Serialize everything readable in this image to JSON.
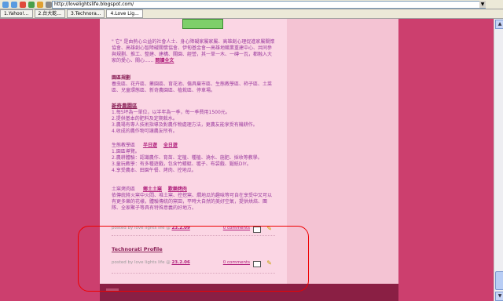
{
  "browser": {
    "address": "http://lovelightslife.blogspot.com/",
    "dropdown_glyph": "▼",
    "tabs": [
      {
        "label": "1.Yahoo!..."
      },
      {
        "label": "2.台大乾..."
      },
      {
        "label": "3.Technora..."
      },
      {
        "label": "4.Love Lig..."
      }
    ]
  },
  "post": {
    "intro": "\" 它\" 是由熱心公益的社會人士、身心障礙家屬家屬、高雄創心理促進家屬關懷協會、高雄創心智障礙關懷協會、伊甸基金會一高雄地職業重建中心、共同參與規劃、推工、整建、建構、關園、經營，其一草一木、一磚一瓦，都融入大家的愛心、關心......",
    "read_more": "閱讀全文",
    "park_title": "園區規劃",
    "park_body": "養虫區、花卉區、藥園區、育花池、傷具棄市區、生態教學區、柿子區、土菜區、兒童環態區、新奇農園區、植栽區、停車場。",
    "farm_title": "新奇農園區",
    "farm_lines": [
      "1.每5坪為一單位，以半年為一季，每一季費用1500元。",
      "2.提供基本的肥料及定期栽水。",
      "3.農場有專人技術指導及對農作物處理方法，更農友能享受有機耕作。",
      "4.收成的農作物可讓農友所有。"
    ],
    "edu_title": "生態教學區",
    "edu_links": [
      "半日遊",
      "全日遊"
    ],
    "edu_lines": [
      "1.園區導覽。",
      "2.農耕體驗：認識農作、育苗、定植、種植、澆水、施肥、採收等教學。",
      "3.童玩教學：有多種遊戲，包含竹蜻蜓、毽子、布袋戲、鋸紙DIY。",
      "4.享受農本、田園午餐、烤肉、控地瓜。"
    ],
    "soil_title": "土窯烤肉區",
    "soil_links": [
      "鄉土土窯",
      "歡樂烤肉"
    ],
    "soil_body": "依傳統將火窯中火悶、堆土窯、控挖窯、燜地瓜的趣味等可自在享受中又可以有更多樂的花樣，體驗傳統的窯田，平時大自然的美好空氣，提供烘焙、團隊、全家聚子等具有特殊意義的好地方。",
    "footer1": {
      "posted": "posted by love lights life @",
      "time": "23.2.09",
      "comments": "0 comments"
    }
  },
  "post2": {
    "title": "Technorati Profile",
    "posted": "posted by love lights life @",
    "time": "23.2.06",
    "comments": "0 comments"
  },
  "colors": {
    "background": "#cc3f6e",
    "content": "#fbd6e4",
    "link": "#b0207c"
  },
  "icons": [
    "back-icon",
    "forward-icon",
    "stop-icon",
    "refresh-icon",
    "home-icon",
    "mail-icon",
    "pencil-icon"
  ]
}
